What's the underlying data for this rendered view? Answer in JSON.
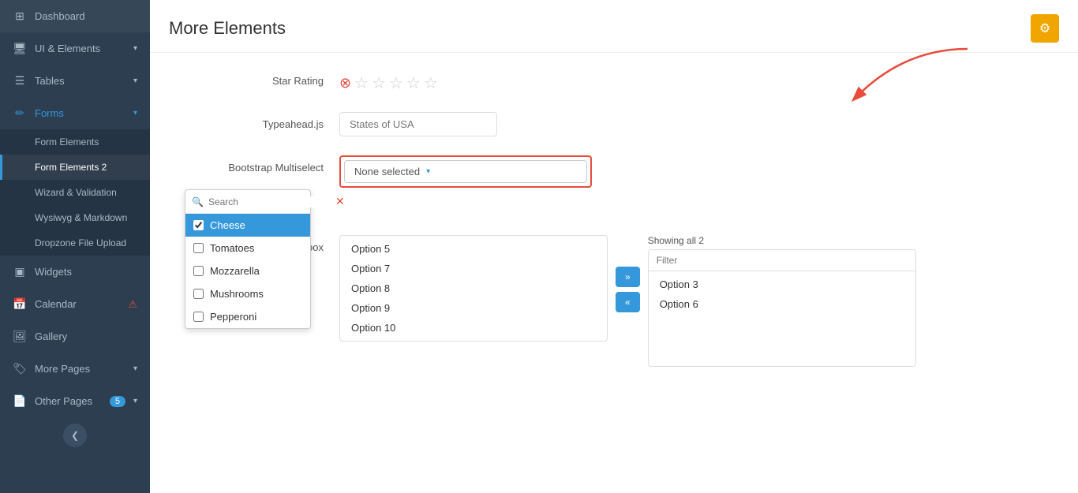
{
  "sidebar": {
    "items": [
      {
        "id": "dashboard",
        "label": "Dashboard",
        "icon": "⊞",
        "hasArrow": false
      },
      {
        "id": "ui-elements",
        "label": "UI & Elements",
        "icon": "🖥",
        "hasArrow": true
      },
      {
        "id": "tables",
        "label": "Tables",
        "icon": "☰",
        "hasArrow": true
      },
      {
        "id": "forms",
        "label": "Forms",
        "icon": "✏",
        "hasArrow": true,
        "active": true
      }
    ],
    "forms_submenu": [
      {
        "id": "form-elements",
        "label": "Form Elements"
      },
      {
        "id": "form-elements-2",
        "label": "Form Elements 2",
        "active": true
      },
      {
        "id": "wizard-validation",
        "label": "Wizard & Validation"
      },
      {
        "id": "wysiwyg-markdown",
        "label": "Wysiwyg & Markdown"
      },
      {
        "id": "dropzone-upload",
        "label": "Dropzone File Upload"
      }
    ],
    "other_items": [
      {
        "id": "widgets",
        "label": "Widgets",
        "icon": "▣"
      },
      {
        "id": "calendar",
        "label": "Calendar",
        "icon": "📅",
        "hasWarning": true
      },
      {
        "id": "gallery",
        "label": "Gallery",
        "icon": "🖼"
      },
      {
        "id": "more-pages",
        "label": "More Pages",
        "icon": "🏷",
        "hasArrow": true
      },
      {
        "id": "other-pages",
        "label": "Other Pages",
        "icon": "📄",
        "hasArrow": true,
        "badge": 5
      }
    ],
    "collapse_label": "❮"
  },
  "header": {
    "title": "More Elements",
    "gear_icon": "⚙"
  },
  "star_rating": {
    "label": "Star Rating",
    "reset_icon": "⊗",
    "stars": [
      "☆",
      "☆",
      "☆",
      "☆",
      "☆"
    ]
  },
  "typeahead": {
    "label": "Typeahead.js",
    "placeholder": "States of USA"
  },
  "multiselect": {
    "label": "Bootstrap Multiselect",
    "button_text": "None selected",
    "caret": "▾",
    "search_placeholder": "Search",
    "clear_icon": "✕",
    "options": [
      {
        "id": "cheese",
        "label": "Cheese",
        "selected": true
      },
      {
        "id": "tomatoes",
        "label": "Tomatoes",
        "selected": false
      },
      {
        "id": "mozzarella",
        "label": "Mozzarella",
        "selected": false
      },
      {
        "id": "mushrooms",
        "label": "Mushrooms",
        "selected": false
      },
      {
        "id": "pepperoni",
        "label": "Pepperoni",
        "selected": false
      }
    ]
  },
  "dual_listbox": {
    "label": "Dual listbox",
    "showing_label": "Showing all 2",
    "filter_placeholder": "Filter",
    "left_options": [
      "Option 5",
      "Option 7",
      "Option 8",
      "Option 9",
      "Option 10"
    ],
    "right_options": [
      "Option 3",
      "Option 6"
    ],
    "forward_arrows": "»",
    "back_arrows": "«"
  }
}
